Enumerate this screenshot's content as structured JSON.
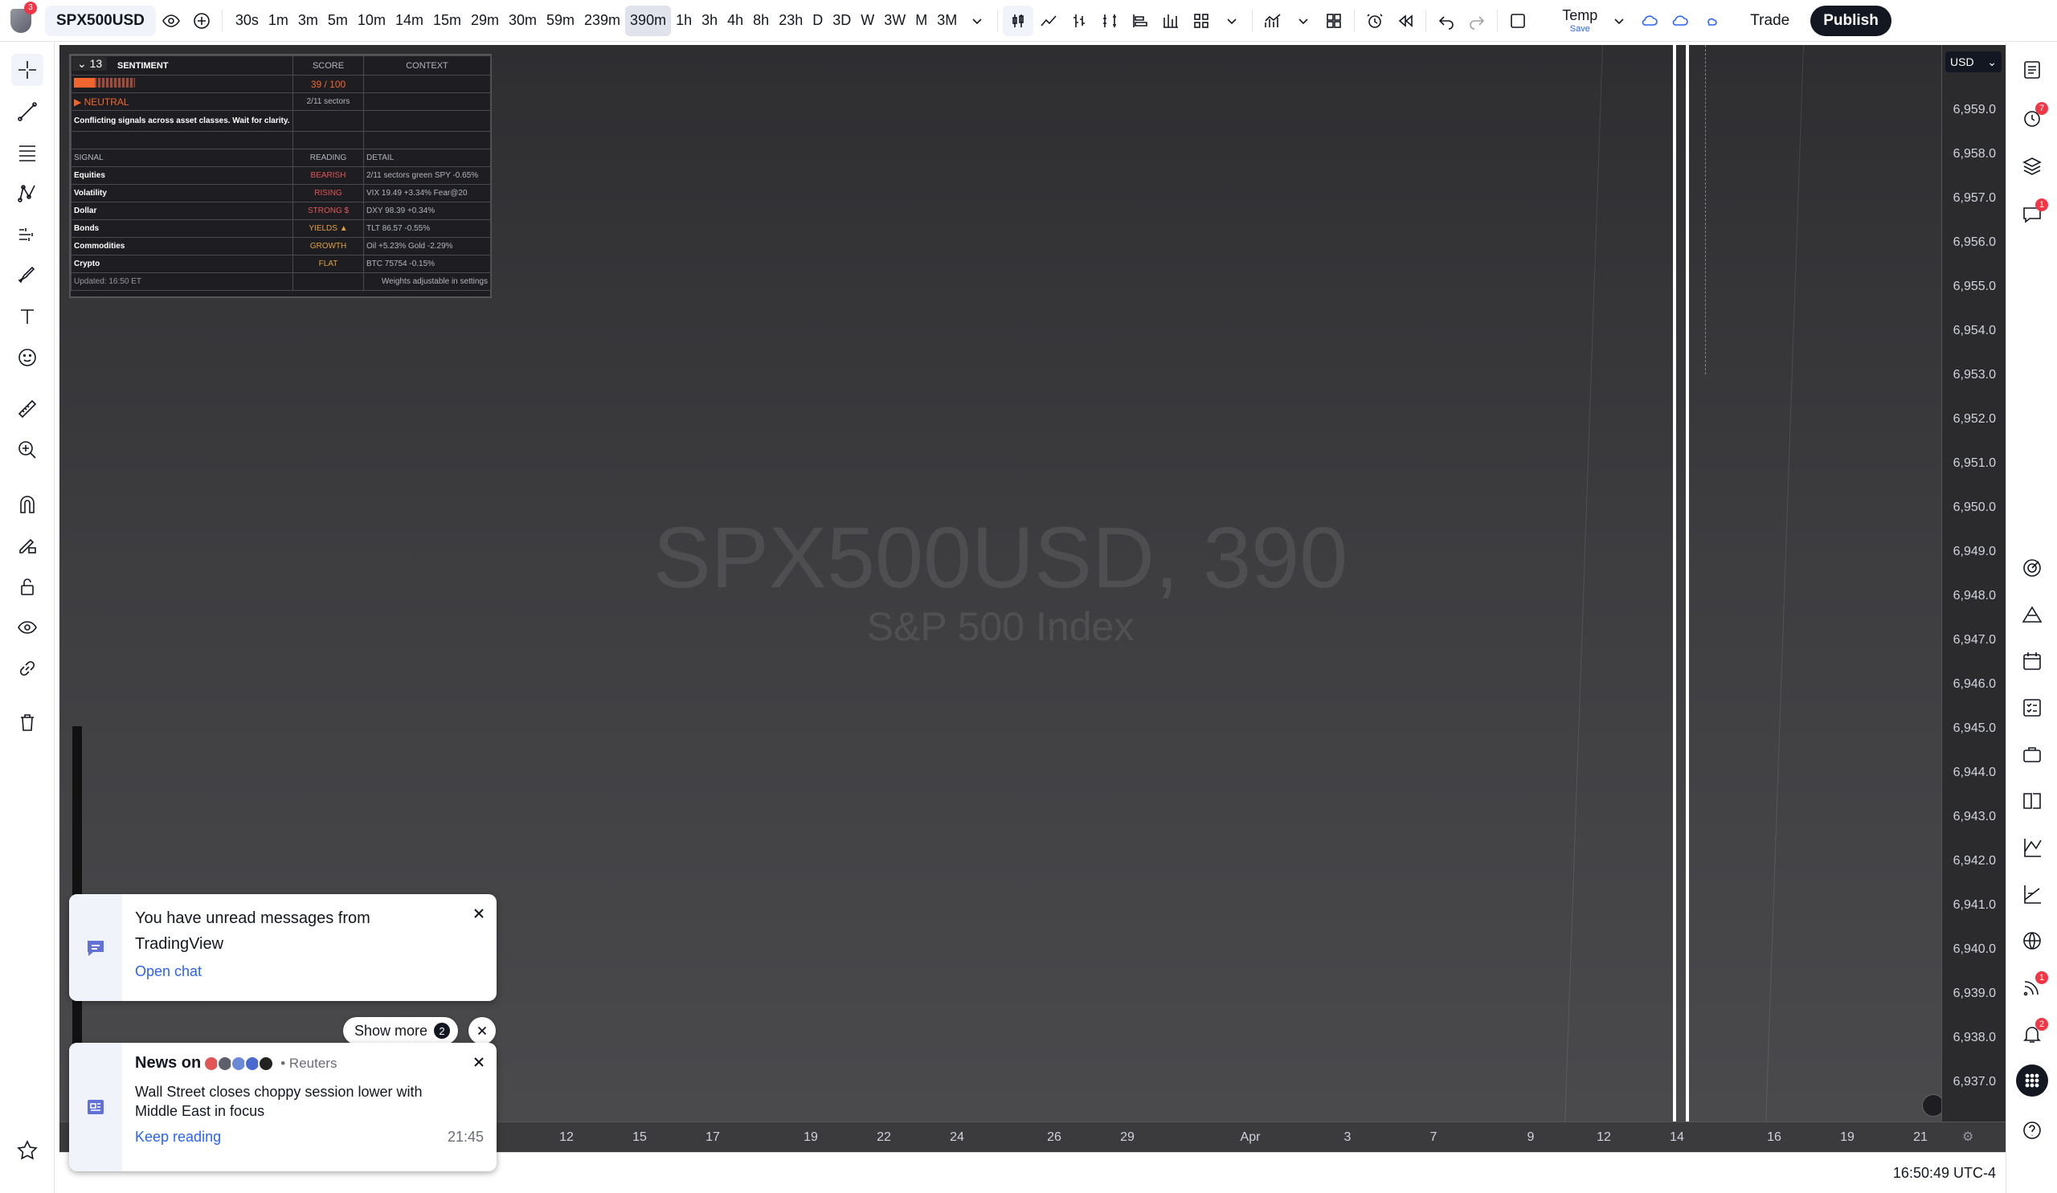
{
  "topbar": {
    "logo_badge": "3",
    "symbol": "SPX500USD",
    "intervals": [
      "30s",
      "1m",
      "3m",
      "5m",
      "10m",
      "14m",
      "15m",
      "29m",
      "30m",
      "59m",
      "239m",
      "390m",
      "1h",
      "3h",
      "4h",
      "8h",
      "23h",
      "D",
      "3D",
      "W",
      "3W",
      "M",
      "3M"
    ],
    "active_interval": "390m",
    "layout_name": "Temp",
    "layout_save": "Save",
    "trade_label": "Trade",
    "publish_label": "Publish"
  },
  "chart": {
    "watermark_title": "SPX500USD, 390",
    "watermark_subtitle": "S&P 500 Index",
    "currency": "USD",
    "price_labels": [
      "6,959.0",
      "6,958.0",
      "6,957.0",
      "6,956.0",
      "6,955.0",
      "6,954.0",
      "6,953.0",
      "6,952.0",
      "6,951.0",
      "6,950.0",
      "6,949.0",
      "6,948.0",
      "6,947.0",
      "6,946.0",
      "6,945.0",
      "6,944.0",
      "6,943.0",
      "6,942.0",
      "6,941.0",
      "6,940.0",
      "6,939.0",
      "6,938.0",
      "6,937.0"
    ],
    "time_labels": [
      "12",
      "15",
      "17",
      "19",
      "22",
      "24",
      "26",
      "29",
      "Apr",
      "3",
      "7",
      "9",
      "12",
      "14",
      "16",
      "19",
      "21"
    ]
  },
  "sentiment": {
    "badge": "13",
    "header": [
      "SENTIMENT",
      "SCORE",
      "CONTEXT"
    ],
    "score": "39 / 100",
    "state": "▶ NEUTRAL",
    "sectors": "2/11 sectors",
    "message": "Conflicting signals across asset classes. Wait for clarity.",
    "table_header": [
      "SIGNAL",
      "READING",
      "DETAIL"
    ],
    "rows": [
      {
        "signal": "Equities",
        "reading": "BEARISH",
        "detail": "2/11 sectors green  SPY -0.65%",
        "color": "#e05555"
      },
      {
        "signal": "Volatility",
        "reading": "RISING",
        "detail": "VIX 19.49  +3.34%  Fear@20",
        "color": "#e05555"
      },
      {
        "signal": "Dollar",
        "reading": "STRONG $",
        "detail": "DXY 98.39  +0.34%",
        "color": "#e05555"
      },
      {
        "signal": "Bonds",
        "reading": "YIELDS ▲",
        "detail": "TLT 86.57  -0.55%",
        "color": "#e0a040"
      },
      {
        "signal": "Commodities",
        "reading": "GROWTH",
        "detail": "Oil +5.23%  Gold -2.29%",
        "color": "#e0a040"
      },
      {
        "signal": "Crypto",
        "reading": "FLAT",
        "detail": "BTC 75754  -0.15%",
        "color": "#e0a040"
      }
    ],
    "updated": "Updated: 16:50 ET",
    "footer": "Weights adjustable in settings"
  },
  "notifications": {
    "chat_title": "You have unread messages from TradingView",
    "chat_link": "Open chat",
    "show_more": "Show more",
    "show_more_count": "2",
    "news_prefix": "News on",
    "news_source": "• Reuters",
    "news_headline": "Wall Street closes choppy session lower with Middle East in focus",
    "news_link": "Keep reading",
    "news_time": "21:45"
  },
  "rightbar": {
    "alerts_count": "7",
    "chat_count": "1",
    "feed_count": "1",
    "notif_count": "2"
  },
  "bottom": {
    "clock": "16:50:49 UTC-4"
  }
}
